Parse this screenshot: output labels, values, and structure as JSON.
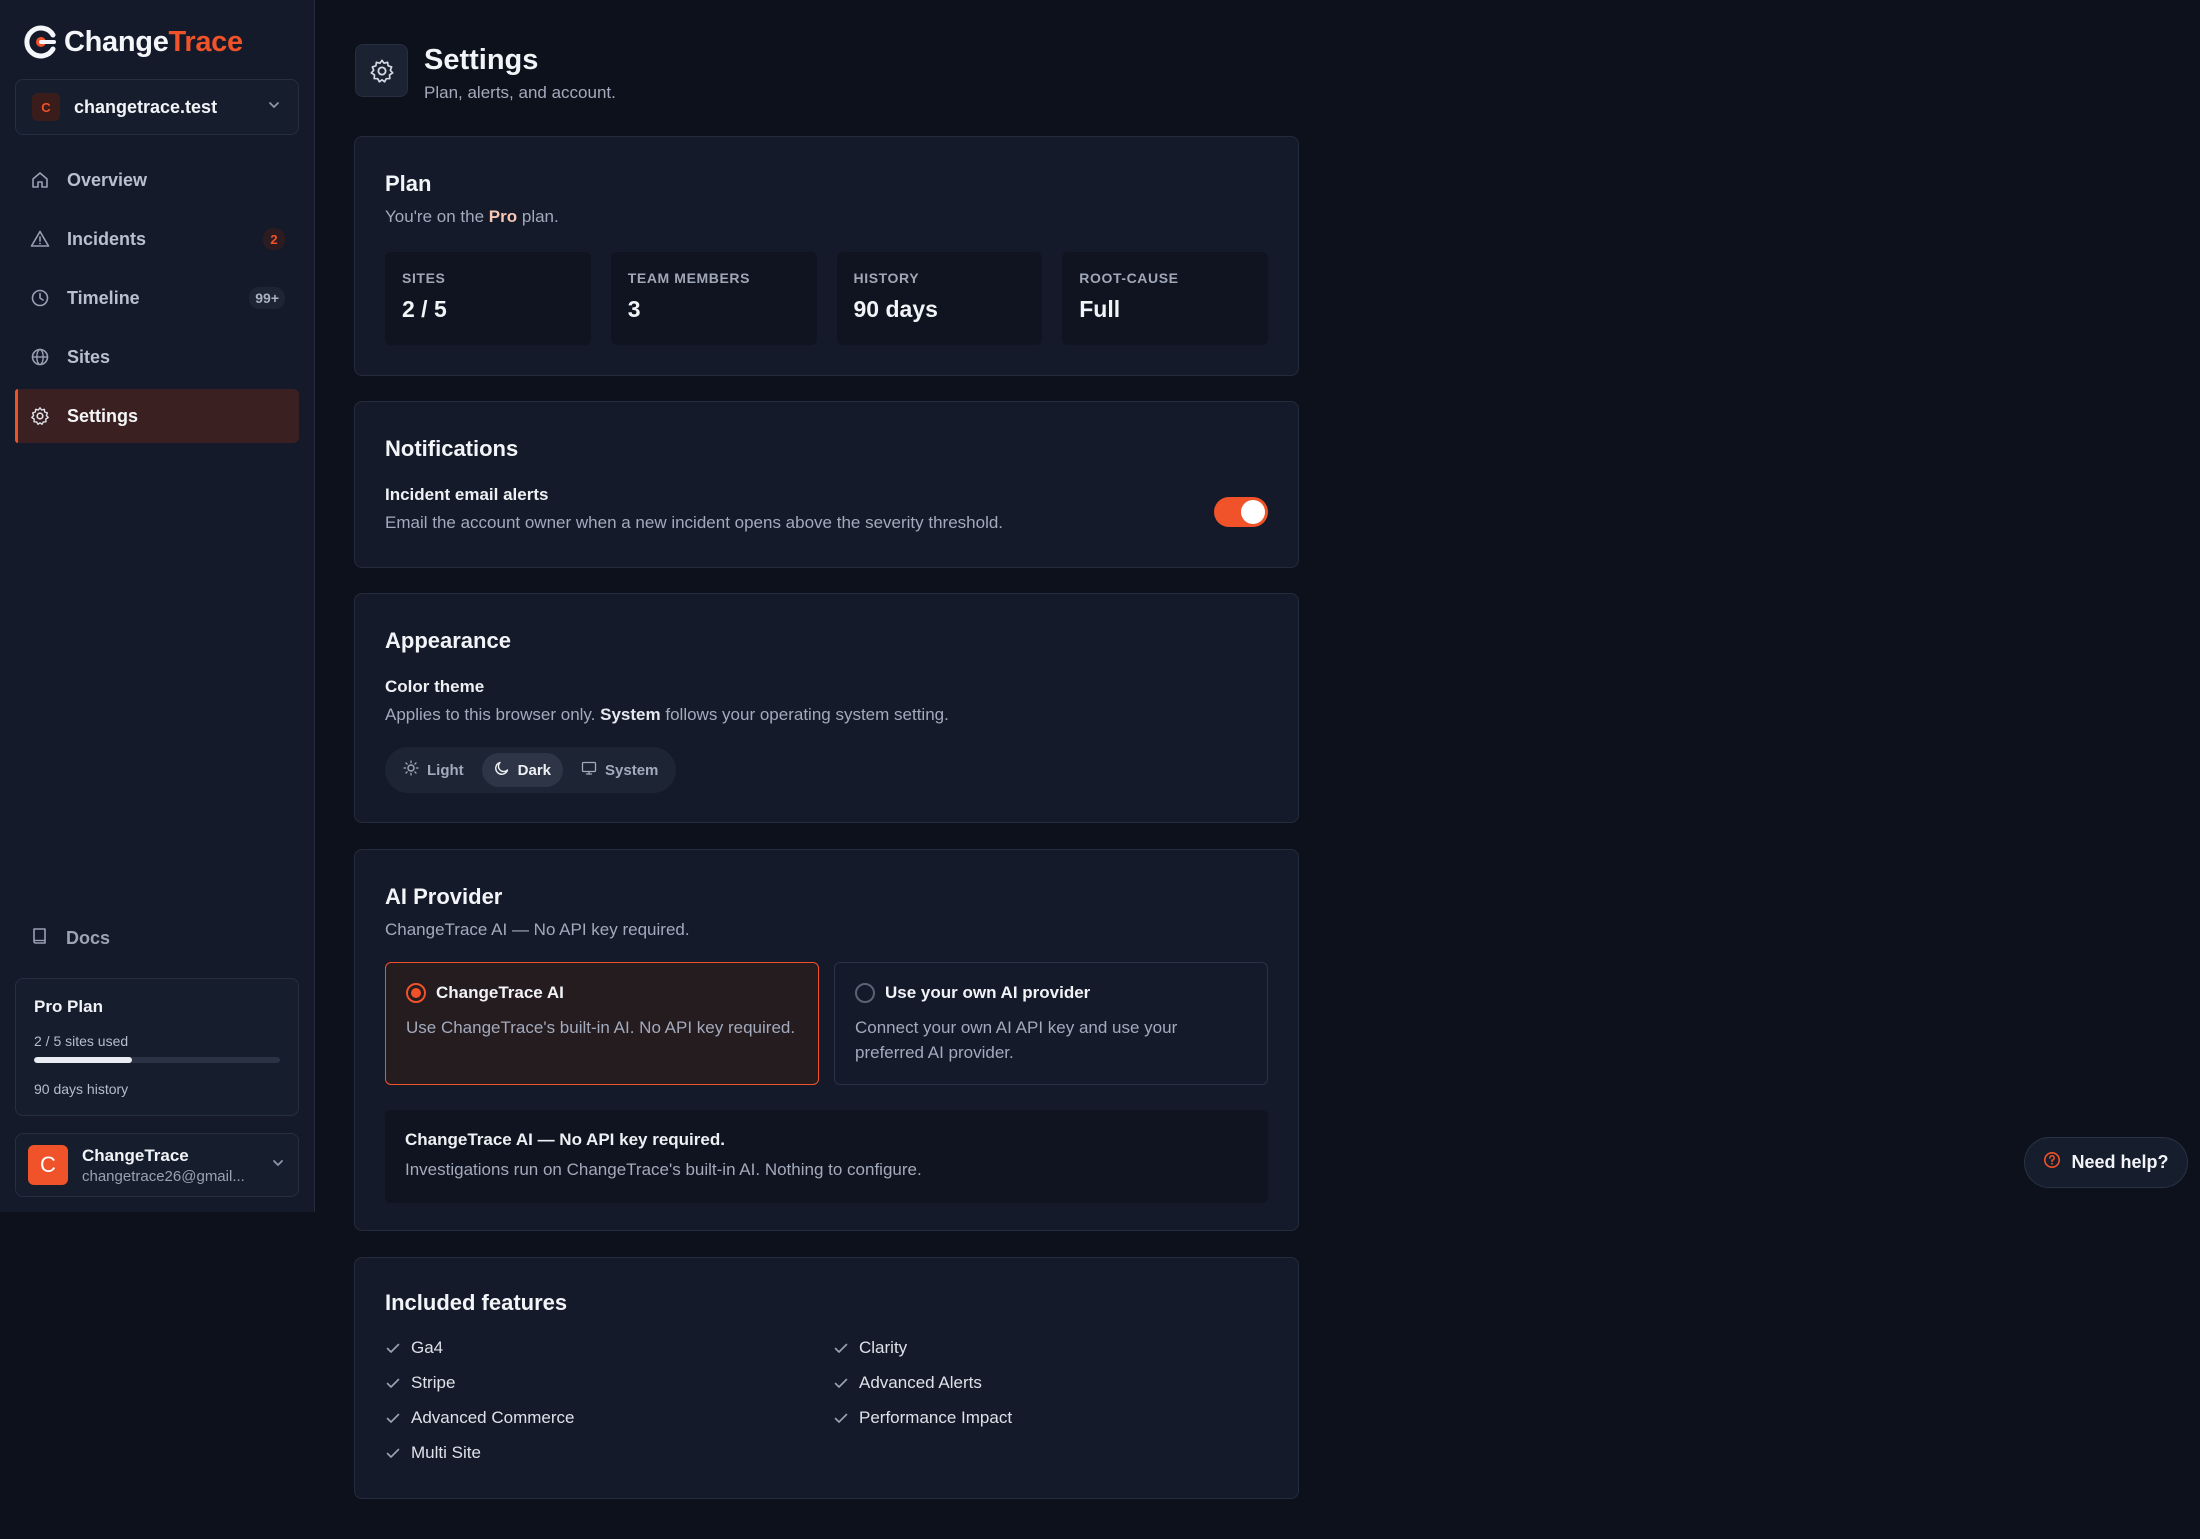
{
  "brand": {
    "name_a": "Change",
    "name_b": "Trace",
    "accent": "#f0522a"
  },
  "workspace": {
    "initial": "C",
    "name": "changetrace.test"
  },
  "nav": [
    {
      "label": "Overview",
      "icon": "home-icon",
      "badge": ""
    },
    {
      "label": "Incidents",
      "icon": "alert-triangle-icon",
      "badge": "2"
    },
    {
      "label": "Timeline",
      "icon": "clock-icon",
      "badge": "99+"
    },
    {
      "label": "Sites",
      "icon": "globe-icon",
      "badge": ""
    },
    {
      "label": "Settings",
      "icon": "gear-icon",
      "badge": "",
      "active": true
    }
  ],
  "docs": {
    "label": "Docs"
  },
  "plan_card": {
    "title": "Pro Plan",
    "used": "2 / 5 sites used",
    "usage_fraction": 0.4,
    "history": "90 days history"
  },
  "user": {
    "initial": "C",
    "name": "ChangeTrace",
    "email": "changetrace26@gmail..."
  },
  "page": {
    "title": "Settings",
    "subtitle": "Plan, alerts, and account."
  },
  "plan": {
    "title": "Plan",
    "sub_prefix": "You're on the",
    "plan_name": "Pro",
    "sub_suffix": "plan.",
    "stats": [
      {
        "label": "SITES",
        "value": "2 / 5"
      },
      {
        "label": "TEAM MEMBERS",
        "value": "3"
      },
      {
        "label": "HISTORY",
        "value": "90 days"
      },
      {
        "label": "ROOT-CAUSE",
        "value": "Full"
      }
    ]
  },
  "notifications": {
    "title": "Notifications",
    "row_label": "Incident email alerts",
    "row_desc": "Email the account owner when a new incident opens above the severity threshold.",
    "enabled": true
  },
  "appearance": {
    "title": "Appearance",
    "row_label": "Color theme",
    "desc_prefix": "Applies to this browser only.",
    "desc_strong": "System",
    "desc_suffix": "follows your operating system setting.",
    "options": [
      "Light",
      "Dark",
      "System"
    ],
    "selected": "Dark"
  },
  "ai_provider": {
    "title": "AI Provider",
    "subtitle": "ChangeTrace AI — No API key required.",
    "options": [
      {
        "title": "ChangeTrace AI",
        "desc": "Use ChangeTrace's built-in AI. No API key required.",
        "selected": true
      },
      {
        "title": "Use your own AI provider",
        "desc": "Connect your own AI API key and use your preferred AI provider.",
        "selected": false
      }
    ],
    "info_title": "ChangeTrace AI — No API key required.",
    "info_desc": "Investigations run on ChangeTrace's built-in AI. Nothing to configure."
  },
  "features": {
    "title": "Included features",
    "items": [
      "Ga4",
      "Clarity",
      "Stripe",
      "Advanced Alerts",
      "Advanced Commerce",
      "Performance Impact",
      "Multi Site"
    ]
  },
  "help": {
    "label": "Need help?"
  }
}
